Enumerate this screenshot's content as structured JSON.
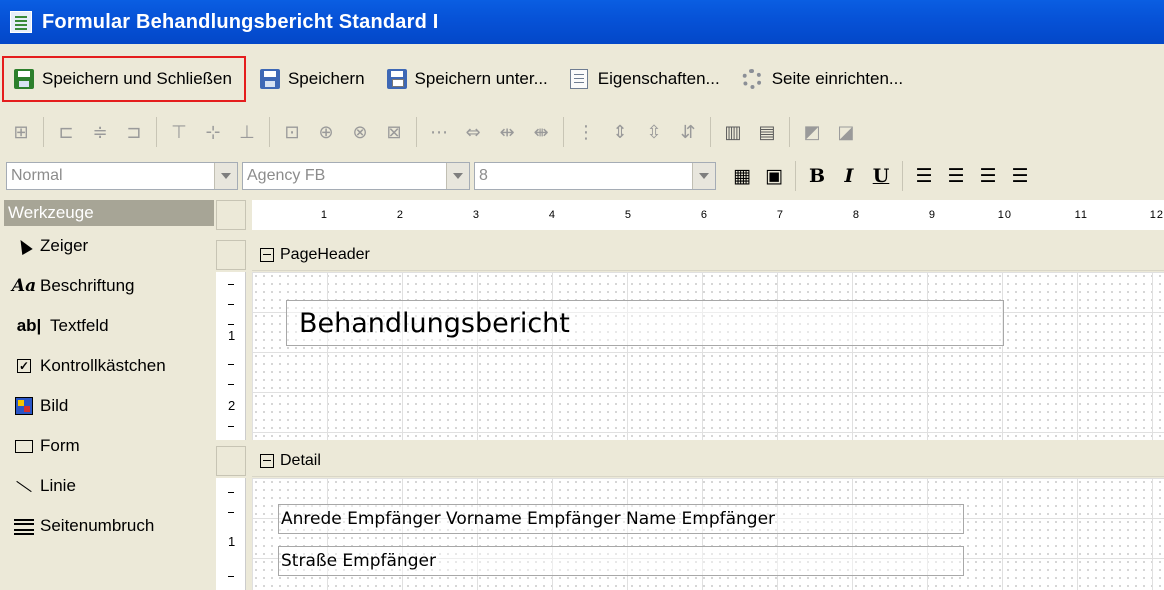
{
  "window": {
    "title": "Formular Behandlungsbericht Standard I"
  },
  "toolbar": {
    "save_close": "Speichern und Schließen",
    "save": "Speichern",
    "save_as": "Speichern unter...",
    "properties": "Eigenschaften...",
    "page_setup": "Seite einrichten..."
  },
  "format": {
    "style": "Normal",
    "font": "Agency FB",
    "size": "8",
    "bold": "B",
    "italic": "I",
    "underline": "U"
  },
  "toolbox": {
    "header": "Werkzeuge",
    "items": [
      {
        "label": "Zeiger"
      },
      {
        "label": "Beschriftung"
      },
      {
        "label": "Textfeld"
      },
      {
        "label": "Kontrollkästchen"
      },
      {
        "label": "Bild"
      },
      {
        "label": "Form"
      },
      {
        "label": "Linie"
      },
      {
        "label": "Seitenumbruch"
      }
    ],
    "label_icon_text": "Aa",
    "textfield_icon_text": "ab|"
  },
  "ruler": {
    "ticks": [
      "1",
      "2",
      "3",
      "4",
      "5",
      "6",
      "7",
      "8",
      "9",
      "10",
      "11",
      "12"
    ],
    "vertical_page_header": [
      "1",
      "2"
    ],
    "vertical_detail": [
      "1"
    ]
  },
  "sections": {
    "page_header": {
      "name": "PageHeader",
      "title_label": "Behandlungsbericht"
    },
    "detail": {
      "name": "Detail",
      "field_name": "Anrede Empfänger Vorname Empfänger Name Empfänger",
      "field_street": "Straße Empfänger"
    }
  },
  "colors": {
    "titlebar": "#0753d8",
    "highlight_border": "#e51d1d",
    "toolbox_header": "#a7a596",
    "chrome": "#ece9d8"
  }
}
